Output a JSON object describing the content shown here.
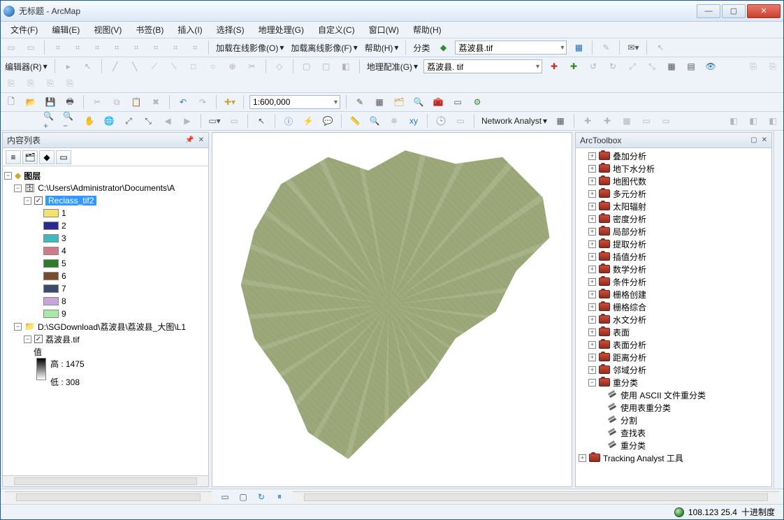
{
  "window": {
    "title": "无标题 - ArcMap"
  },
  "menus": [
    "文件(F)",
    "编辑(E)",
    "视图(V)",
    "书签(B)",
    "插入(I)",
    "选择(S)",
    "地理处理(G)",
    "自定义(C)",
    "窗口(W)",
    "帮助(H)"
  ],
  "toolbar1": {
    "loadOnline": "加载在线影像(O)",
    "loadOffline": "加载离线影像(F)",
    "help": "帮助(H)",
    "classify": "分类",
    "classifyLayer": "荔波县.tif"
  },
  "toolbar2": {
    "editor": "编辑器(R)",
    "georef": "地理配准(G)",
    "georefLayer": "荔波县. tif"
  },
  "toolbar3": {
    "scale": "1:600,000"
  },
  "toolbar4": {
    "networkAnalyst": "Network Analyst"
  },
  "tocPanel": {
    "title": "内容列表",
    "rootLabel": "图层",
    "ds1": "C:\\Users\\Administrator\\Documents\\A",
    "layer1": "Reclass_tif2",
    "legend": [
      {
        "v": "1",
        "c": "#f4e36a"
      },
      {
        "v": "2",
        "c": "#2a2a8f"
      },
      {
        "v": "3",
        "c": "#3cbac0"
      },
      {
        "v": "4",
        "c": "#d07a8a"
      },
      {
        "v": "5",
        "c": "#2e7a2e"
      },
      {
        "v": "6",
        "c": "#7a4a2c"
      },
      {
        "v": "7",
        "c": "#3a4a6a"
      },
      {
        "v": "8",
        "c": "#c9a6d8"
      },
      {
        "v": "9",
        "c": "#a8e8a8"
      }
    ],
    "ds2": "D:\\SGDownload\\荔波县\\荔波县_大图\\L1",
    "layer2": "荔波县.tif",
    "layer2_valueLabel": "值",
    "layer2_highLabel": "高 : 1475",
    "layer2_lowLabel": "低 : 308"
  },
  "toolboxPanel": {
    "title": "ArcToolbox",
    "toolsets": [
      "叠加分析",
      "地下水分析",
      "地图代数",
      "多元分析",
      "太阳辐射",
      "密度分析",
      "局部分析",
      "提取分析",
      "插值分析",
      "数学分析",
      "条件分析",
      "栅格创建",
      "栅格综合",
      "水文分析",
      "表面",
      "表面分析",
      "距离分析",
      "邻域分析"
    ],
    "openToolset": "重分类",
    "openTools": [
      "使用 ASCII 文件重分类",
      "使用表重分类",
      "分割",
      "查找表",
      "重分类"
    ],
    "lastToolbox": "Tracking Analyst 工具"
  },
  "status": {
    "coords": "108.123  25.4",
    "units": "十进制度"
  }
}
